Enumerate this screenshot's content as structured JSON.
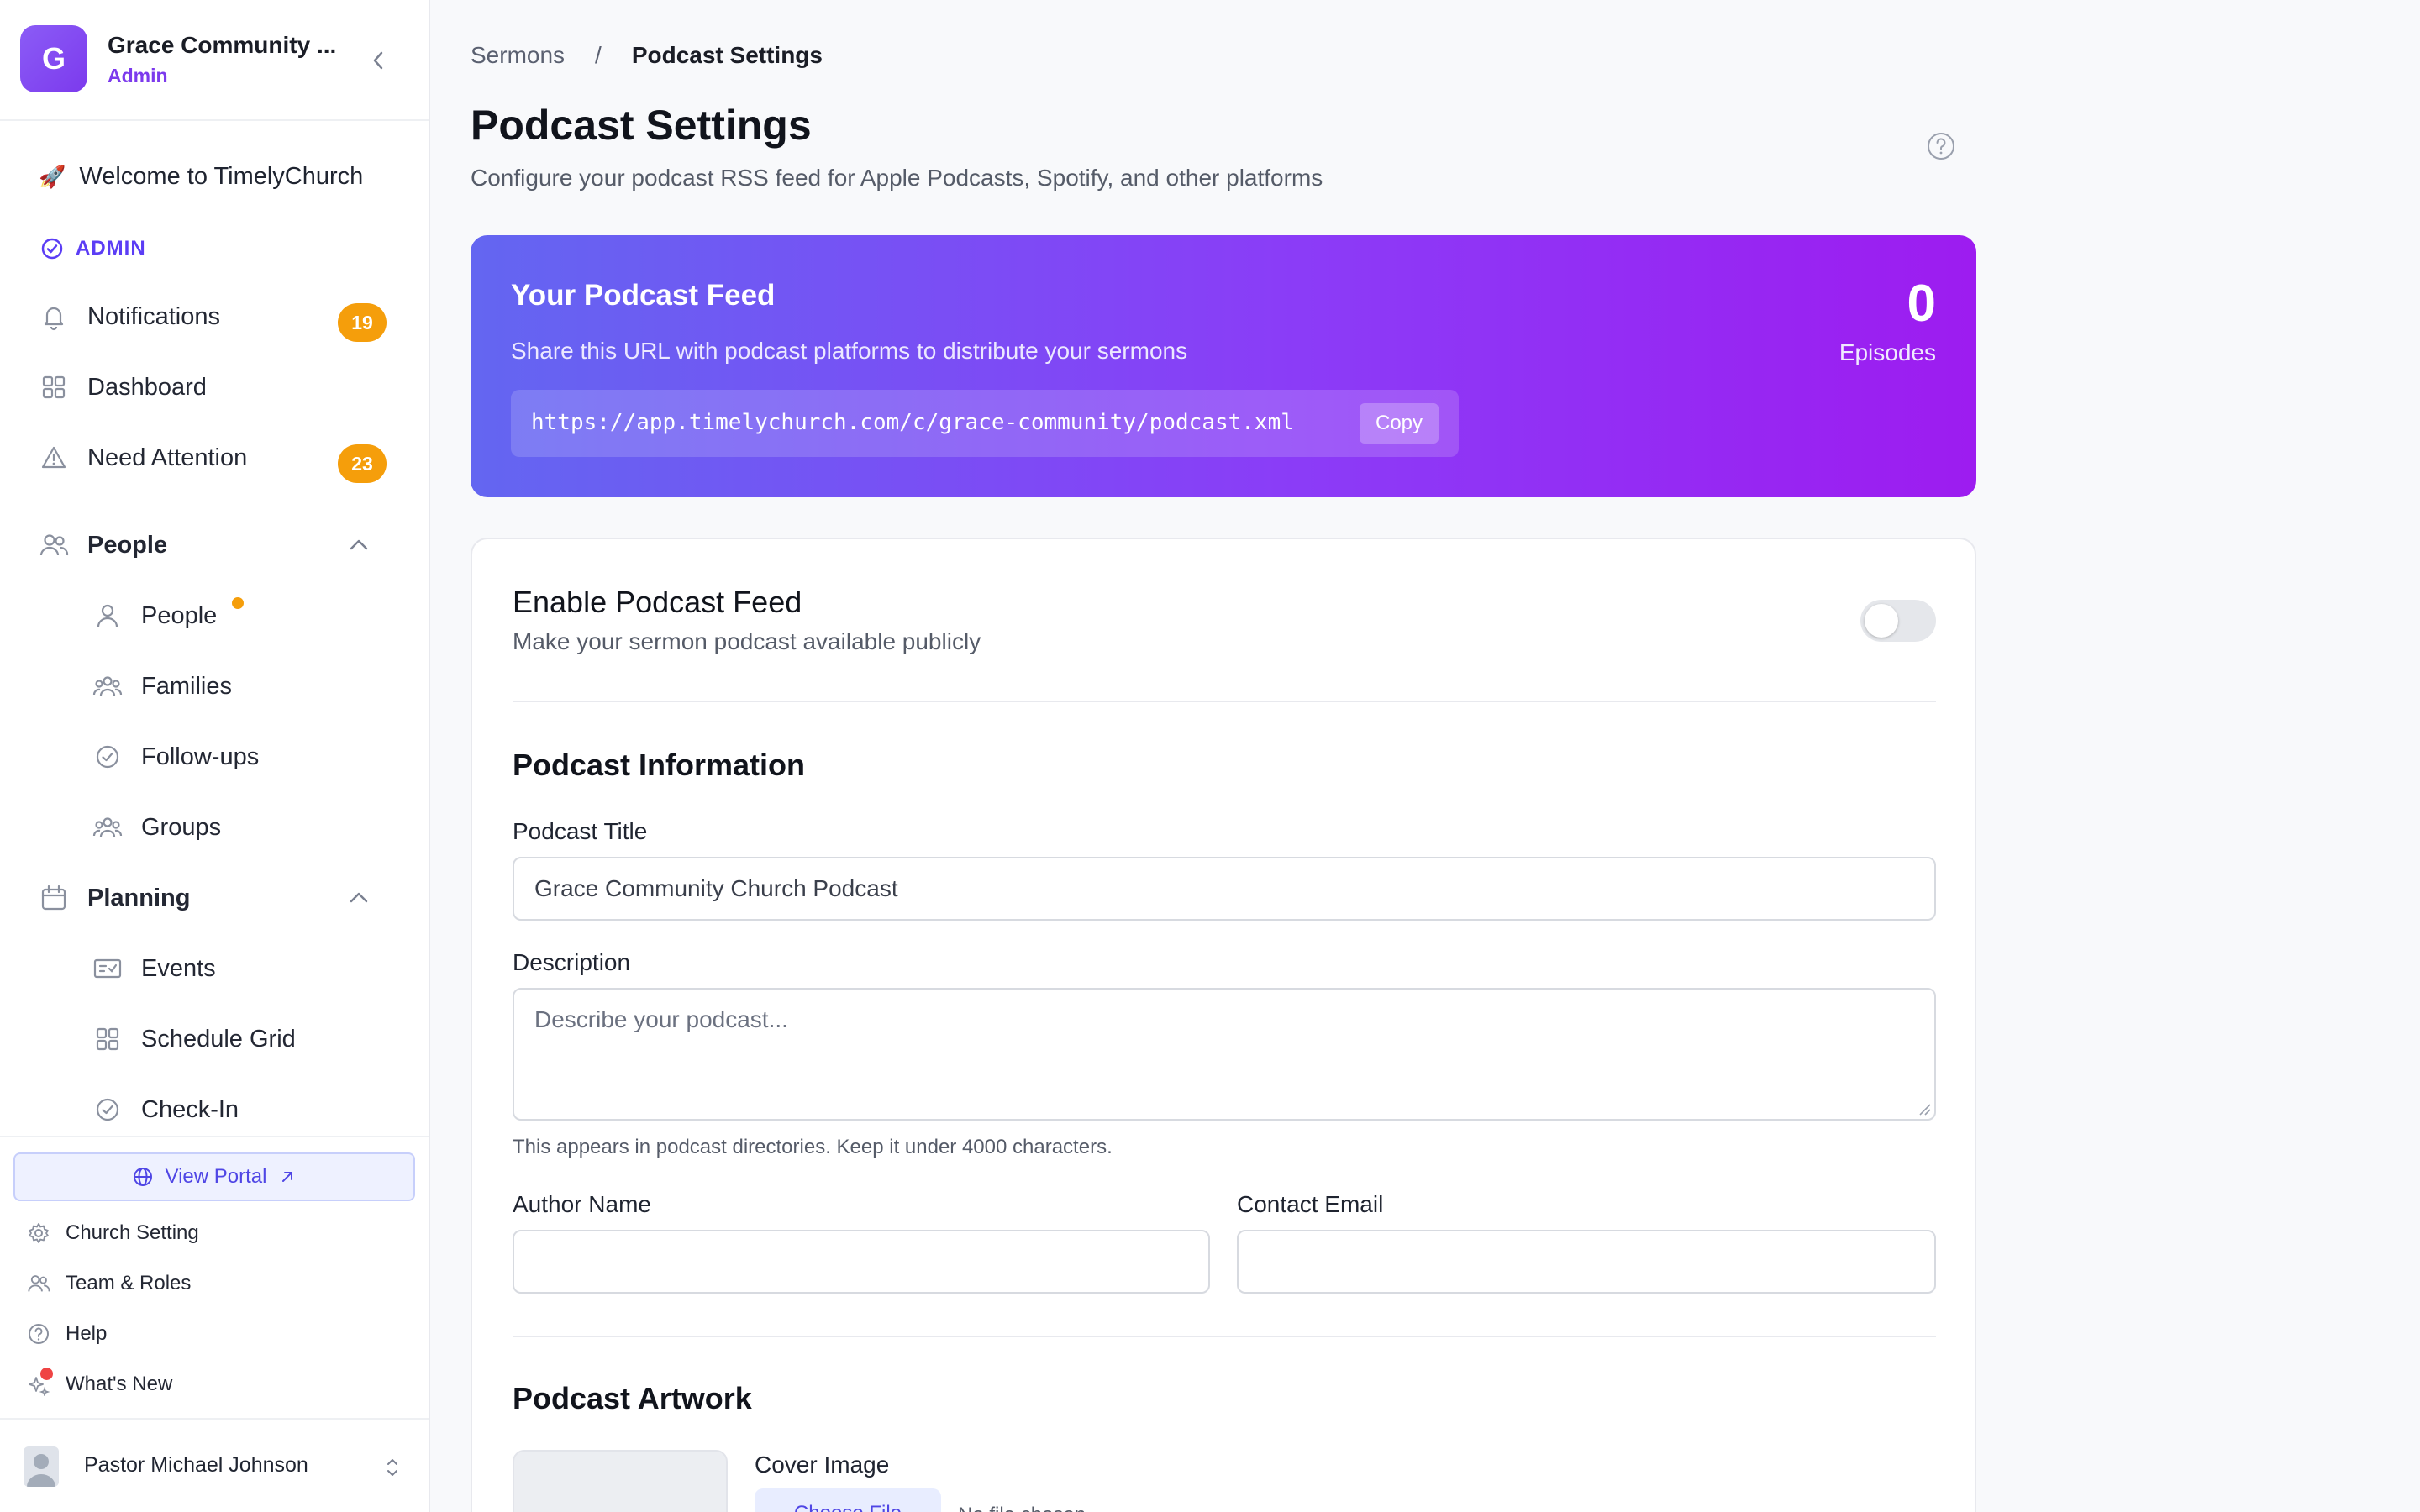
{
  "org": {
    "initial": "G",
    "name": "Grace Community ...",
    "role": "Admin"
  },
  "nav": {
    "welcome": "Welcome to TimelyChurch",
    "welcome_emoji": "🚀",
    "admin_section": "ADMIN",
    "items": [
      {
        "label": "Notifications",
        "icon": "bell-icon",
        "badge": "19"
      },
      {
        "label": "Dashboard",
        "icon": "grid-icon"
      },
      {
        "label": "Need Attention",
        "icon": "warning-icon",
        "badge": "23"
      }
    ],
    "people_group": {
      "label": "People",
      "icon": "users-icon",
      "items": [
        {
          "label": "People",
          "icon": "user-icon"
        },
        {
          "label": "Families",
          "icon": "family-icon"
        },
        {
          "label": "Follow-ups",
          "icon": "check-circle-icon"
        },
        {
          "label": "Groups",
          "icon": "groups-icon"
        }
      ]
    },
    "planning_group": {
      "label": "Planning",
      "icon": "calendar-icon",
      "items": [
        {
          "label": "Events",
          "icon": "ticket-icon"
        },
        {
          "label": "Schedule Grid",
          "icon": "grid-icon"
        },
        {
          "label": "Check-In",
          "icon": "check-circle-icon"
        }
      ]
    }
  },
  "sidebar_bottom": {
    "view_portal": "View Portal",
    "links": [
      {
        "label": "Church Setting",
        "icon": "gear-icon"
      },
      {
        "label": "Team & Roles",
        "icon": "users-icon"
      },
      {
        "label": "Help",
        "icon": "help-circle-icon"
      },
      {
        "label": "What's New",
        "icon": "sparkles-icon"
      }
    ]
  },
  "user": {
    "name": "Pastor Michael Johnson"
  },
  "breadcrumb": {
    "parent": "Sermons",
    "separator": "/",
    "current": "Podcast Settings"
  },
  "page": {
    "title": "Podcast Settings",
    "subtitle": "Configure your podcast RSS feed for Apple Podcasts, Spotify, and other platforms"
  },
  "feed": {
    "title": "Your Podcast Feed",
    "description": "Share this URL with podcast platforms to distribute your sermons",
    "url": "https://app.timelychurch.com/c/grace-community/podcast.xml",
    "copy_label": "Copy",
    "episodes_count": "0",
    "episodes_label": "Episodes"
  },
  "enable": {
    "title": "Enable Podcast Feed",
    "description": "Make your sermon podcast available publicly",
    "enabled": false
  },
  "info": {
    "section_title": "Podcast Information",
    "title_label": "Podcast Title",
    "title_value": "Grace Community Church Podcast",
    "description_label": "Description",
    "description_placeholder": "Describe your podcast...",
    "description_hint": "This appears in podcast directories. Keep it under 4000 characters.",
    "author_label": "Author Name",
    "author_value": "",
    "email_label": "Contact Email",
    "email_value": ""
  },
  "artwork": {
    "section_title": "Podcast Artwork",
    "cover_label": "Cover Image",
    "choose_file": "Choose File",
    "no_file": "No file chosen"
  },
  "colors": {
    "accent": "#7c3aed",
    "badge": "#f59e0b",
    "feed_gradient_start": "#6366f1",
    "feed_gradient_end": "#9d1cf0"
  }
}
